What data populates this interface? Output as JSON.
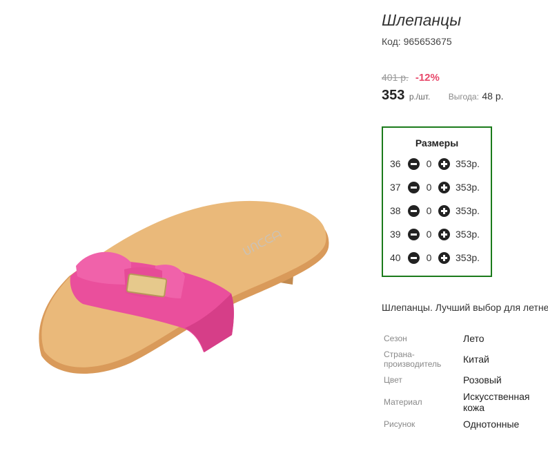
{
  "product": {
    "title": "Шлепанцы",
    "code": "Код: 965653675",
    "old_price": "401 р.",
    "discount": "-12%",
    "price": "353",
    "price_unit": "р./шт.",
    "benefit_label": "Выгода:",
    "benefit_value": "48 р."
  },
  "sizes": {
    "title": "Размеры",
    "rows": [
      {
        "size": "36",
        "qty": "0",
        "price": "353р."
      },
      {
        "size": "37",
        "qty": "0",
        "price": "353р."
      },
      {
        "size": "38",
        "qty": "0",
        "price": "353р."
      },
      {
        "size": "39",
        "qty": "0",
        "price": "353р."
      },
      {
        "size": "40",
        "qty": "0",
        "price": "353р."
      }
    ]
  },
  "description": "Шлепанцы. Лучший выбор для летне",
  "specs": [
    {
      "label": "Сезон",
      "value": "Лето"
    },
    {
      "label": "Страна-\nпроизводитель",
      "value": "Китай"
    },
    {
      "label": "Цвет",
      "value": "Розовый"
    },
    {
      "label": "Материал",
      "value": "Искусственная\nкожа"
    },
    {
      "label": "Рисунок",
      "value": "Однотонные"
    }
  ],
  "colors": {
    "accent_discount": "#e8486a",
    "sizes_border": "#1a7a1a",
    "sole": "#eab97a",
    "strap": "#ea4f9c"
  },
  "icons": [
    "minus-circle-icon",
    "plus-circle-icon"
  ]
}
